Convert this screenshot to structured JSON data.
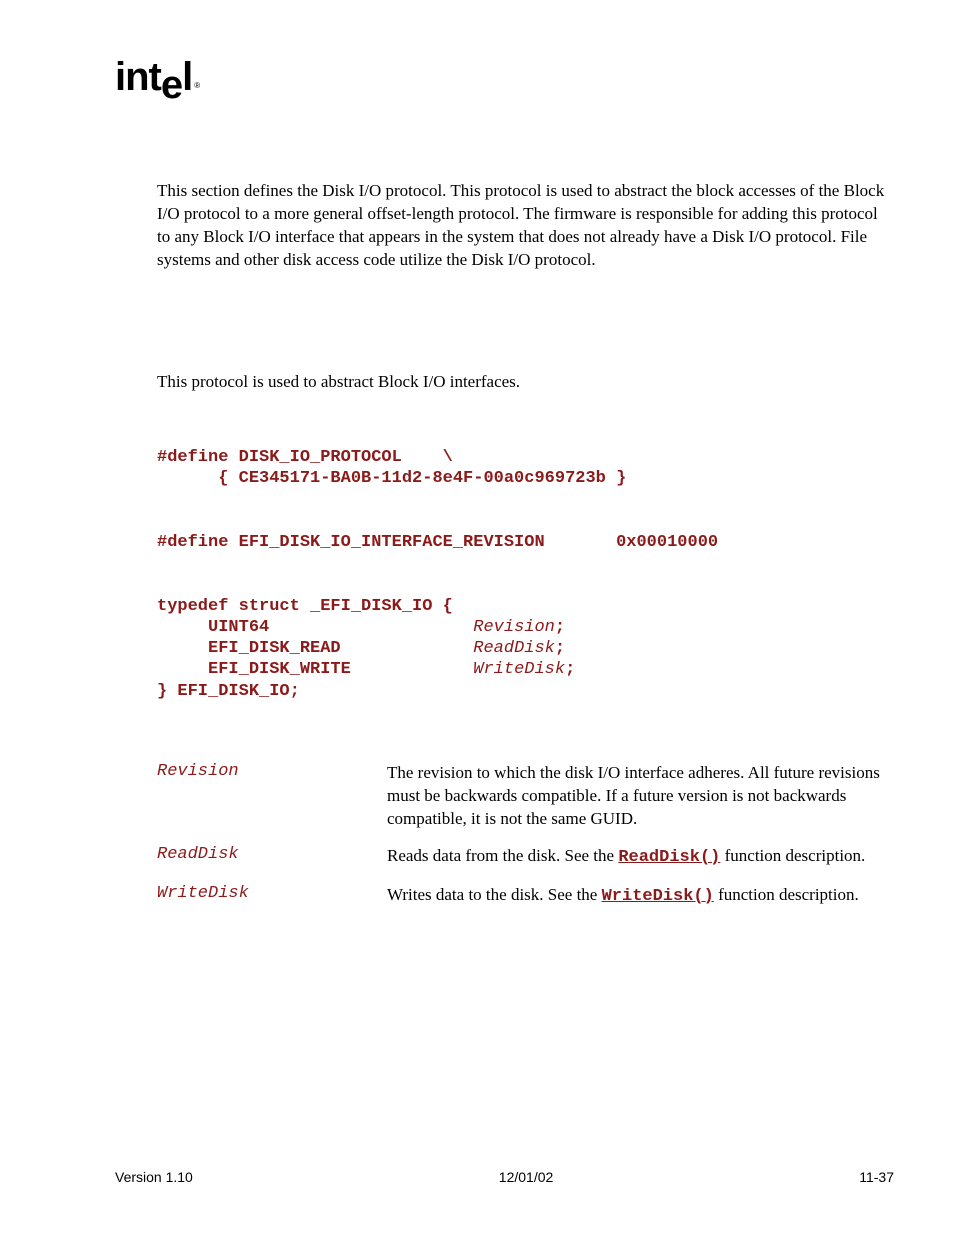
{
  "logo_text": "intel",
  "intro_paragraph": "This section defines the Disk I/O protocol.  This protocol is used to abstract the block accesses of the Block I/O protocol to a more general offset-length protocol.  The firmware is responsible for adding this protocol to any Block I/O interface that appears in the system that does not already have a Disk I/O protocol.  File systems and other disk access code utilize the Disk I/O protocol.",
  "sub_paragraph": "This protocol is used to abstract Block I/O interfaces.",
  "code": {
    "define1_a": "#define DISK_IO_PROTOCOL    \\",
    "define1_b": "      { CE345171-BA0B-11d2-8e4F-00a0c969723b }",
    "define2": "#define EFI_DISK_IO_INTERFACE_REVISION       0x00010000",
    "struct1": "typedef struct _EFI_DISK_IO {",
    "struct2a": "     UINT64                    ",
    "struct2b": "Revision",
    "struct2c": ";",
    "struct3a": "     EFI_DISK_READ             ",
    "struct3b": "ReadDisk",
    "struct3c": ";",
    "struct4a": "     EFI_DISK_WRITE            ",
    "struct4b": "WriteDisk",
    "struct4c": ";",
    "struct5": "} EFI_DISK_IO;"
  },
  "params": [
    {
      "name": "Revision",
      "desc": "The revision to which the disk I/O interface adheres.  All future revisions must be backwards compatible.  If a future version is not backwards compatible, it is not the same GUID."
    },
    {
      "name": "ReadDisk",
      "desc_pre": "Reads data from the disk.  See the ",
      "link": "ReadDisk()",
      "desc_post": " function description."
    },
    {
      "name": "WriteDisk",
      "desc_pre": "Writes data to the disk.  See the ",
      "link": "WriteDisk()",
      "desc_post": " function description."
    }
  ],
  "footer": {
    "left": "Version 1.10",
    "center": "12/01/02",
    "right": "11-37"
  }
}
